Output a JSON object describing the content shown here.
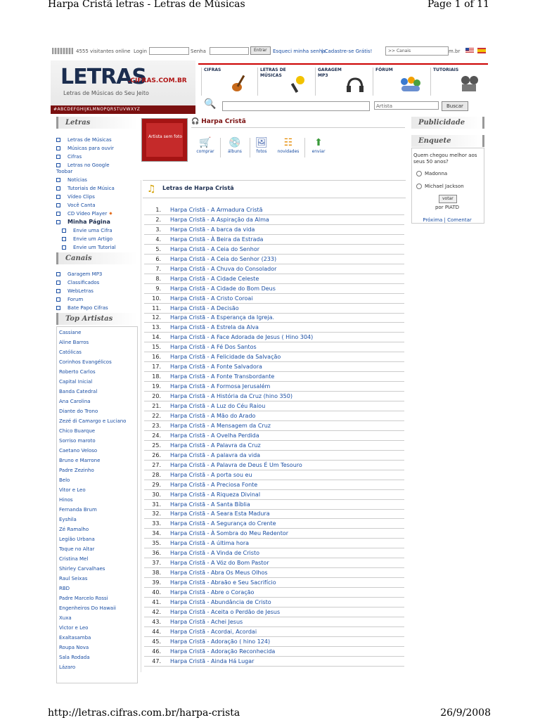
{
  "print": {
    "title": "Harpa Cristã letras - Letras de Músicas",
    "page": "Page 1 of 11",
    "url": "http://letras.cifras.com.br/harpa-crista",
    "date": "26/9/2008"
  },
  "topbar": {
    "visitors": "4555 visitantes online",
    "login_label": "Login",
    "password_label": "Senha",
    "enter_button": "Entrar",
    "forgot": "Esqueci minha senha.",
    "signup": "| Cadastre-se Grátis!",
    "canais": ">> Canais",
    "domain_suffix": "m.br"
  },
  "header": {
    "logo": "LETRAS",
    "logo_domain": ".CIFRAS.COM.BR",
    "tagline": "Letras de Músicas do Seu Jeito",
    "alphabet": "#ABCDEFGHIJKLMNOPQRSTUVWXYZ",
    "nav": [
      "CIFRAS",
      "LETRAS DE MÚSICAS",
      "GARAGEM MP3",
      "FÓRUM",
      "TUTORIAIS"
    ],
    "search_select": "Artista",
    "search_button": "Buscar"
  },
  "sidebar": {
    "letras_title": "Letras",
    "letras_links": [
      "Letras de Músicas",
      "Músicas para ouvir",
      "Cifras",
      "Letras no Google Toobar",
      "Notícias",
      "Tutoriais de Música",
      "Vídeo Clips",
      "Você Canta",
      "CD Vídeo Player"
    ],
    "minha_pagina": "Minha Página",
    "minha_links": [
      "Envie uma Cifra",
      "Envie um Artigo",
      "Envie um Tutorial"
    ],
    "canais_title": "Canais",
    "canais_links": [
      "Garagem MP3",
      "Classificados",
      "WebLetras",
      "Forum",
      "Bate Papo Cifras"
    ],
    "top_title": "Top Artistas",
    "artists": [
      "Cassiane",
      "Aline Barros",
      "Católicas",
      "Corinhos Evangélicos",
      "Roberto Carlos",
      "Capital Inicial",
      "Banda Catedral",
      "Ana Carolina",
      "Diante do Trono",
      "Zezé di Camargo e Luciano",
      "Chico Buarque",
      "Sorriso maroto",
      "Caetano Veloso",
      "Bruno e Marrone",
      "Padre Zezinho",
      "Belo",
      "Vitor e Leo",
      "Hinos",
      "Fernanda Brum",
      "Eyshila",
      "Zé Ramalho",
      "Legião Urbana",
      "Toque no Altar",
      "Cristina Mel",
      "Shirley Carvalhaes",
      "Raul Seixas",
      "RBD",
      "Padre Marcelo Rossi",
      "Engenheiros Do Hawaii",
      "Xuxa",
      "Victor e Leo",
      "Exaltasamba",
      "Roupa Nova",
      "Sala Rodada",
      "Lázaro"
    ]
  },
  "artist": {
    "photo_text": "Artista sem foto",
    "name": "Harpa Cristã",
    "actions": [
      "comprar",
      "álbuns",
      "fotos",
      "novidades",
      "enviar"
    ],
    "list_title": "Letras de Harpa Cristã"
  },
  "songs": [
    "Harpa Cristã - A Armadura Cristã",
    "Harpa Cristã - A Aspiração da Alma",
    "Harpa Cristã - A barca da vida",
    "Harpa Cristã - À Beira da Estrada",
    "Harpa Cristã - A Ceia do Senhor",
    "Harpa Cristã - A Ceia do Senhor (233)",
    "Harpa Cristã - A Chuva do Consolador",
    "Harpa Cristã - A Cidade Celeste",
    "Harpa Cristã - A Cidade do Bom Deus",
    "Harpa Cristã - A Cristo Coroai",
    "Harpa Cristã - A Decisão",
    "Harpa Cristã - A Esperança da Igreja.",
    "Harpa Cristã - A Estrela da Alva",
    "Harpa Cristã - A Face Adorada de Jesus ( Hino 304)",
    "Harpa Cristã - A Fé Dos Santos",
    "Harpa Cristã - A Felicidade da Salvação",
    "Harpa Cristã - A Fonte Salvadora",
    "Harpa Cristã - A Fonte Transbordante",
    "Harpa Cristã - A Formosa Jerusalém",
    "Harpa Cristã - A História da Cruz (hino 350)",
    "Harpa Cristã - A Luz do Céu Raiou",
    "Harpa Cristã - A Mão do Arado",
    "Harpa Cristã - A Mensagem da Cruz",
    "Harpa Cristã - A Ovelha Perdida",
    "Harpa Cristã - A Palavra da Cruz",
    "Harpa Cristã - A palavra da vida",
    "Harpa Cristã - A Palavra de Deus É Um Tesouro",
    "Harpa Cristã - A porta sou eu",
    "Harpa Cristã - A Preciosa Fonte",
    "Harpa Cristã - A Riqueza Divinal",
    "Harpa Cristã - A Santa Bíblia",
    "Harpa Cristã - A Seara Esta Madura",
    "Harpa Cristã - A Segurança do Crente",
    "Harpa Cristã - À Sombra do Meu Redentor",
    "Harpa Cristã - A última hora",
    "Harpa Cristã - A Vinda de Cristo",
    "Harpa Cristã - A Vóz do Bom Pastor",
    "Harpa Cristã - Abra Os Meus Olhos",
    "Harpa Cristã - Abraão e Seu Sacrifício",
    "Harpa Cristã - Abre o Coração",
    "Harpa Cristã - Abundância de Cristo",
    "Harpa Cristã - Aceita o Perdão de Jesus",
    "Harpa Cristã - Achei Jesus",
    "Harpa Cristã - Acordai, Acordai",
    "Harpa Cristã - Adoração ( hino 124)",
    "Harpa Cristã - Adoração Reconhecida",
    "Harpa Cristã - Ainda Há Lugar"
  ],
  "right": {
    "publicidade": "Publicidade",
    "enquete": "Enquete",
    "question": "Quem chegou melhor aos seus 50 anos?",
    "options": [
      "Madonna",
      "Michael Jackson"
    ],
    "vote": "votar",
    "by": "por PIATD",
    "nav": "Próxima | Comentar"
  }
}
